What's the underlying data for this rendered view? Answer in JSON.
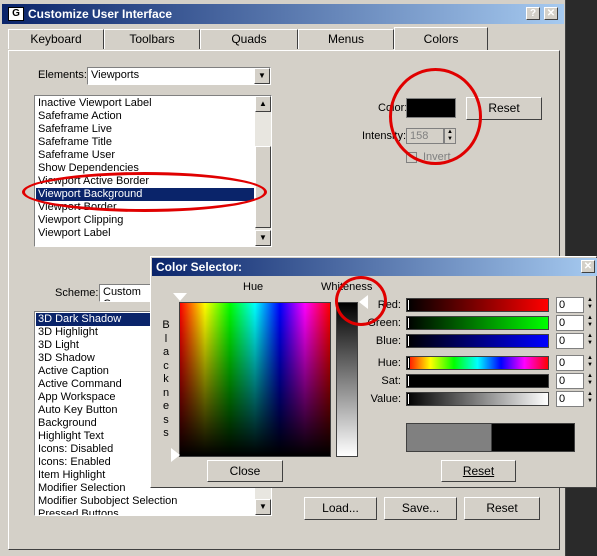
{
  "window": {
    "title": "Customize User Interface",
    "help_btn": "?",
    "close_btn": "✕"
  },
  "tabs": [
    "Keyboard",
    "Toolbars",
    "Quads",
    "Menus",
    "Colors"
  ],
  "elements": {
    "label": "Elements:",
    "value": "Viewports"
  },
  "viewport_list": [
    "Inactive Viewport Label",
    "Safeframe Action",
    "Safeframe Live",
    "Safeframe Title",
    "Safeframe User",
    "Show Dependencies",
    "Viewport Active Border",
    "Viewport Background",
    "Viewport Border",
    "Viewport Clipping",
    "Viewport Label"
  ],
  "color_panel": {
    "color_label": "Color:",
    "reset": "Reset",
    "intensity_label": "Intensity:",
    "intensity_value": "158",
    "invert_label": "Invert",
    "color_swatch": "#000000"
  },
  "scheme": {
    "label": "Scheme:",
    "value": "Custom Co"
  },
  "scheme_list": [
    "3D Dark Shadow",
    "3D Highlight",
    "3D Light",
    "3D Shadow",
    "Active Caption",
    "Active Command",
    "App Workspace",
    "Auto Key Button",
    "Background",
    "Highlight Text",
    "Icons: Disabled",
    "Icons: Enabled",
    "Item Highlight",
    "Modifier Selection",
    "Modifier Subobject Selection",
    "Pressed Buttons"
  ],
  "bottom_buttons": {
    "load": "Load...",
    "save": "Save...",
    "reset": "Reset"
  },
  "selector": {
    "title": "Color Selector:",
    "close_x": "✕",
    "hue_label": "Hue",
    "whiteness_label": "Whiteness",
    "blackness_letters": [
      "B",
      "l",
      "a",
      "c",
      "k",
      "n",
      "e",
      "s",
      "s"
    ],
    "close": "Close",
    "reset": "Reset",
    "sliders": [
      {
        "label": "Red:",
        "value": "0"
      },
      {
        "label": "Green:",
        "value": "0"
      },
      {
        "label": "Blue:",
        "value": "0"
      },
      {
        "label": "Hue:",
        "value": "0"
      },
      {
        "label": "Sat:",
        "value": "0"
      },
      {
        "label": "Value:",
        "value": "0"
      }
    ],
    "preview_old": "#808080",
    "preview_new": "#000000"
  },
  "colors": {
    "title_dark": "#0a246a",
    "face": "#d4d0c8",
    "annotation": "#e00000"
  }
}
